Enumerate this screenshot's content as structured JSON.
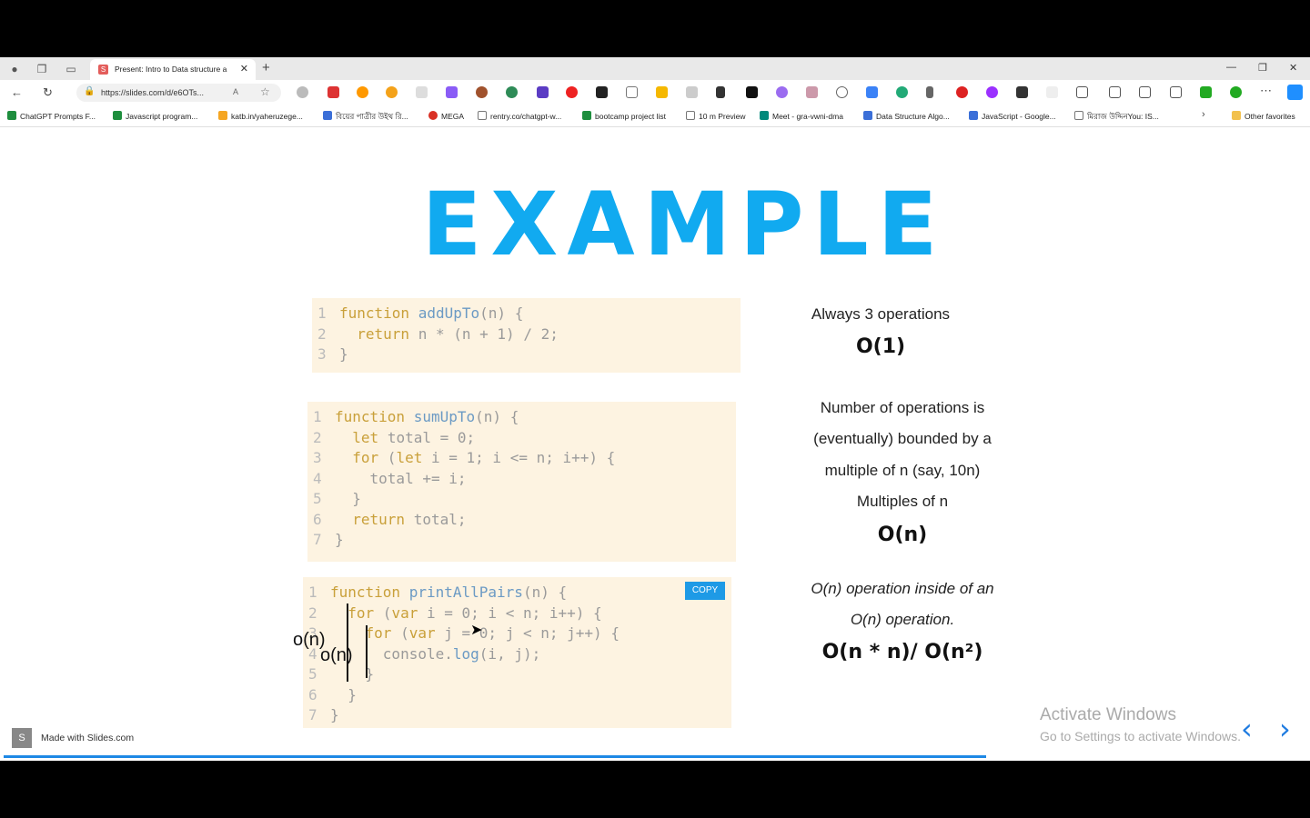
{
  "browser": {
    "tab_title": "Present: Intro to Data structure a",
    "url": "https://slides.com/d/e6OTs...",
    "bookmarks": [
      "ChatGPT Prompts F...",
      "Javascript program...",
      "katb.in/yaheruzege...",
      "বিয়ের পাত্রীর উইথ রি...",
      "MEGA",
      "rentry.co/chatgpt-w...",
      "bootcamp project list",
      "10 m Preview",
      "Meet - gra-vwni-dma",
      "Data Structure Algo...",
      "JavaScript - Google...",
      "মিরাজ উদ্দিনYou: IS..."
    ],
    "other_favorites": "Other favorites"
  },
  "slide": {
    "title": "EXAMPLE",
    "code1": [
      {
        "n": "1",
        "t": "function addUpTo(n) {"
      },
      {
        "n": "2",
        "t": "  return n * (n + 1) / 2;"
      },
      {
        "n": "3",
        "t": "}"
      }
    ],
    "code2": [
      {
        "n": "1",
        "t": "function sumUpTo(n) {"
      },
      {
        "n": "2",
        "t": "  let total = 0;"
      },
      {
        "n": "3",
        "t": "  for (let i = 1; i <= n; i++) {"
      },
      {
        "n": "4",
        "t": "    total += i;"
      },
      {
        "n": "5",
        "t": "  }"
      },
      {
        "n": "6",
        "t": "  return total;"
      },
      {
        "n": "7",
        "t": "}"
      }
    ],
    "code3": [
      {
        "n": "1",
        "t": "function printAllPairs(n) {"
      },
      {
        "n": "2",
        "t": "  for (var i = 0; i < n; i++) {"
      },
      {
        "n": "3",
        "t": "    for (var j = 0; j < n; j++) {"
      },
      {
        "n": "4",
        "t": "      console.log(i, j);"
      },
      {
        "n": "5",
        "t": "    }"
      },
      {
        "n": "6",
        "t": "  }"
      },
      {
        "n": "7",
        "t": "}"
      }
    ],
    "copy_label": "COPY",
    "annotation_outer": "o(n)",
    "annotation_inner": "o(n)",
    "right1_text": "Always 3 operations",
    "right1_big": "O(1)",
    "right2_line1": "Number of operations is",
    "right2_line2": "(eventually) bounded by a",
    "right2_line3": "multiple of n (say, 10n)",
    "right2_line4": "Multiples of n",
    "right2_big": "O(n)",
    "right3_line1": "O(n) operation inside of an",
    "right3_line2": "O(n) operation.",
    "right3_big": "O(n * n)/ O(n²)",
    "made_with": "Made with Slides.com",
    "activate_title": "Activate Windows",
    "activate_sub": "Go to Settings to activate Windows."
  }
}
